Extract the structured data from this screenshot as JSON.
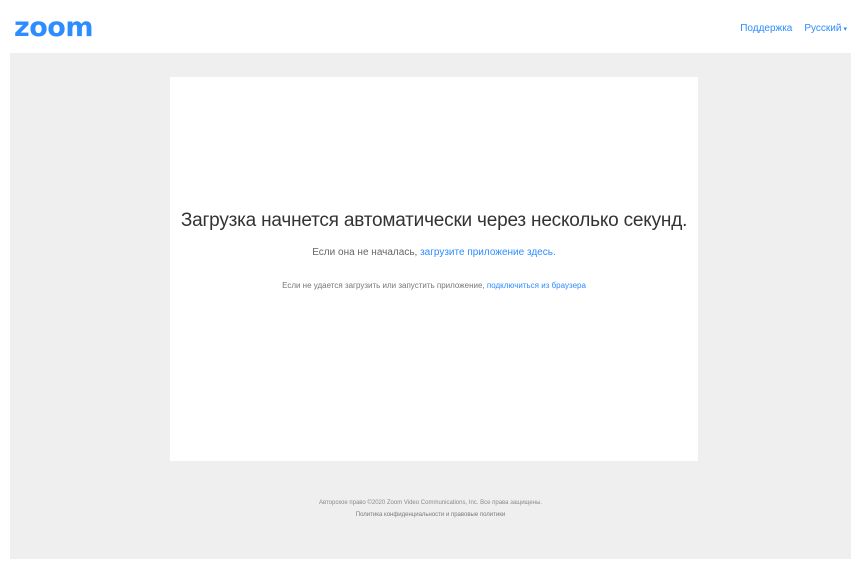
{
  "header": {
    "logo": "zoom",
    "nav": {
      "support": "Поддержка",
      "language": "Русский",
      "language_caret": "▾"
    }
  },
  "main": {
    "headline": "Загрузка начнется автоматически через несколько секунд.",
    "download_prefix": "Если она не началась, ",
    "download_link": "загрузите приложение здесь.",
    "browser_prefix": "Если не удается загрузить или запустить приложение, ",
    "browser_link": "подключиться из браузера"
  },
  "footer": {
    "copyright": "Авторское право ©2020 Zoom Video Communications, Inc. Все права защищены.",
    "policy_link": "Политика конфиденциальности и правовые политики"
  },
  "colors": {
    "brand": "#2d8cff",
    "page_bg": "#efefef",
    "card_bg": "#ffffff"
  }
}
